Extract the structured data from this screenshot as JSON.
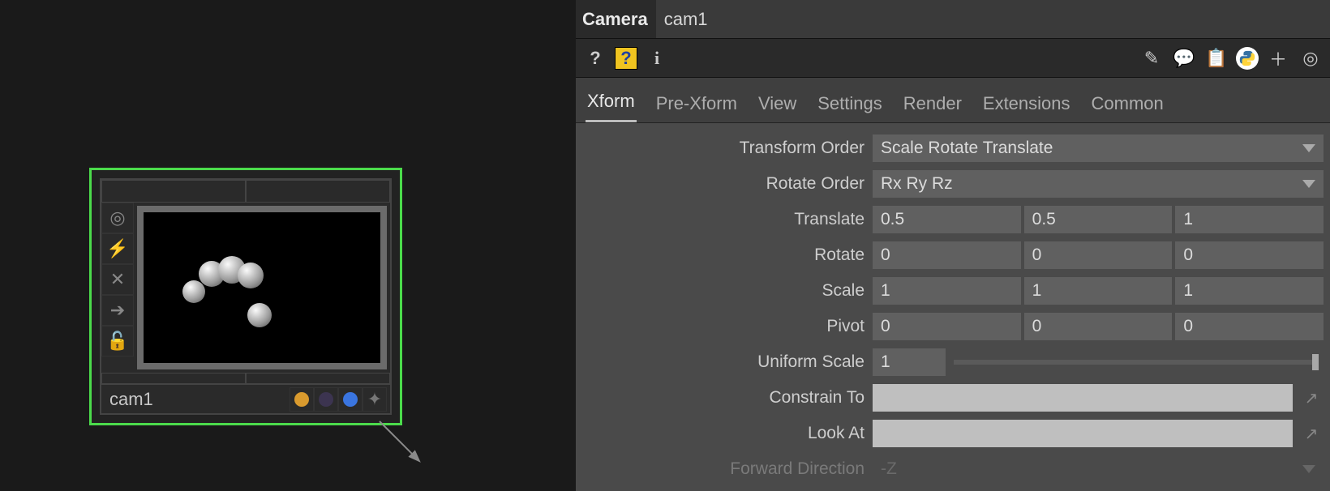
{
  "node": {
    "name": "cam1",
    "tool_icons": [
      "target-icon",
      "bolt-icon",
      "close-icon",
      "arrow-right-icon",
      "lock-icon"
    ],
    "flags": {
      "orange": "#d99a2e",
      "purple": "#3c3450",
      "blue": "#3a75e0"
    }
  },
  "header": {
    "op_type": "Camera",
    "op_name": "cam1"
  },
  "tool_icons_left": {
    "help": "?",
    "help2": "?",
    "info": "i"
  },
  "tool_icons_right": [
    "edit-icon",
    "comment-icon",
    "clipboard-icon",
    "python-icon",
    "plus-icon",
    "target-icon"
  ],
  "tabs": [
    "Xform",
    "Pre-Xform",
    "View",
    "Settings",
    "Render",
    "Extensions",
    "Common"
  ],
  "active_tab": "Xform",
  "params": {
    "transform_order": {
      "label": "Transform Order",
      "value": "Scale Rotate Translate"
    },
    "rotate_order": {
      "label": "Rotate Order",
      "value": "Rx Ry Rz"
    },
    "translate": {
      "label": "Translate",
      "x": "0.5",
      "y": "0.5",
      "z": "1"
    },
    "rotate": {
      "label": "Rotate",
      "x": "0",
      "y": "0",
      "z": "0"
    },
    "scale": {
      "label": "Scale",
      "x": "1",
      "y": "1",
      "z": "1"
    },
    "pivot": {
      "label": "Pivot",
      "x": "0",
      "y": "0",
      "z": "0"
    },
    "uniform_scale": {
      "label": "Uniform Scale",
      "value": "1"
    },
    "constrain_to": {
      "label": "Constrain To",
      "value": ""
    },
    "look_at": {
      "label": "Look At",
      "value": ""
    },
    "forward_dir": {
      "label": "Forward Direction",
      "value": "-Z"
    }
  }
}
